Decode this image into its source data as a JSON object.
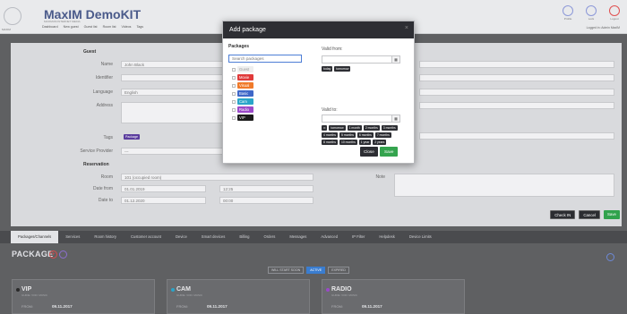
{
  "header": {
    "logo_caption": "MAXIM",
    "brand": "MaxIM DemoKIT",
    "brand_sub": "MAXIMUM INTERNET MEDIA",
    "nav": [
      "Dashboard",
      "New guest",
      "Guest list",
      "Room list",
      "Videos",
      "Tags"
    ],
    "profile_label": "Profile",
    "lock_label": "Lock",
    "logout_label": "Logout",
    "logged_in": "Logged in: Admin MaxIM"
  },
  "guest": {
    "section": "Guest",
    "name_label": "Name",
    "name_value": "John Black",
    "identifier_label": "Identifier",
    "language_label": "Language",
    "language_value": "English",
    "address_label": "Address",
    "tags_label": "Tags",
    "tag_value": "Package",
    "service_provider_label": "Service Provider",
    "service_provider_value": "---"
  },
  "reservation": {
    "section": "Reservation",
    "room_label": "Room",
    "room_value": "101 (occupied room)",
    "note_label": "Note",
    "date_from_label": "Date from",
    "date_from_value": "01.01.2019",
    "time_from_value": "12:25",
    "date_to_label": "Date to",
    "date_to_value": "01.12.2020",
    "time_to_value": "00:00"
  },
  "buttons": {
    "check_in": "Check IN",
    "cancel": "Cancel",
    "save": "Save"
  },
  "tabs": [
    "Packages/Channels",
    "Services",
    "Room history",
    "Customer account",
    "Device",
    "Smart devices",
    "Billing",
    "Orders",
    "Messages",
    "Advanced",
    "IP Filter",
    "Helpdesk",
    "Device Limits"
  ],
  "package_section": {
    "title": "PACKAGE",
    "filters": [
      "WILL START SOON",
      "ACTIVE",
      "EXPIRED"
    ],
    "cards": [
      {
        "name": "VIP",
        "sub": "GUIDE: VOD: MUSIC",
        "from_label": "FROM:",
        "from": "09.11.2017",
        "color": "#2a2a2a"
      },
      {
        "name": "CAM",
        "sub": "GUIDE: VOD: MUSIC",
        "from_label": "FROM:",
        "from": "09.11.2017",
        "color": "#2aa5c9"
      },
      {
        "name": "RADIO",
        "sub": "GUIDE: VOD: MUSIC",
        "from_label": "FROM:",
        "from": "09.11.2017",
        "color": "#9b49c9"
      }
    ]
  },
  "modal": {
    "title": "Add package",
    "packages_label": "Packages",
    "search_placeholder": "Search packages",
    "packages": [
      {
        "label": "Guest",
        "color": "#eeeeee"
      },
      {
        "label": "Movie",
        "color": "#e03a3a"
      },
      {
        "label": "Visual",
        "color": "#f07a2a"
      },
      {
        "label": "Basic",
        "color": "#3f67c8"
      },
      {
        "label": "Cam",
        "color": "#2aa5c9"
      },
      {
        "label": "Radio",
        "color": "#9b49c9"
      },
      {
        "label": "VIP",
        "color": "#1b1b1b"
      }
    ],
    "valid_from_label": "Valid from:",
    "valid_from_chips": [
      "today",
      "tomorrow"
    ],
    "valid_to_label": "Valid to:",
    "valid_to_chips": [
      "∞",
      "tomorrow",
      "1 month",
      "2 months",
      "3 months",
      "4 months",
      "5 months",
      "6 months",
      "7 months",
      "8 months",
      "10 months",
      "1 year",
      "2 years"
    ],
    "close_label": "Close",
    "save_label": "Save"
  }
}
